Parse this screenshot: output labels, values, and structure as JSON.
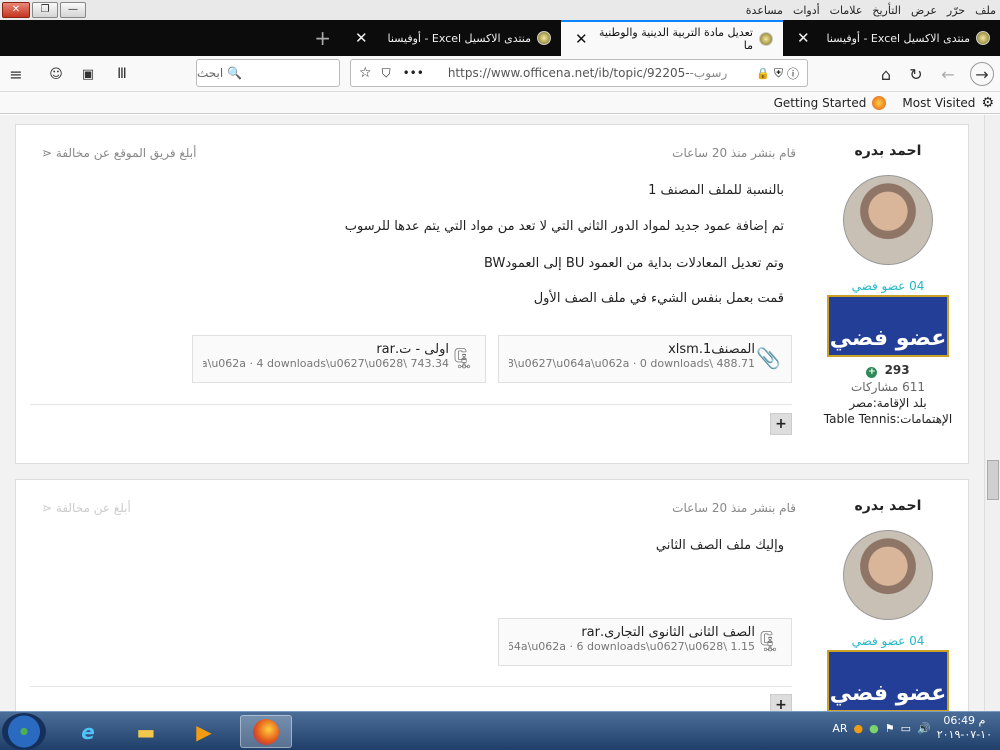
{
  "menu": {
    "items": [
      "ملف",
      "حرّر",
      "عرض",
      "التأريخ",
      "علامات",
      "أدوات",
      "مساعدة"
    ]
  },
  "window": {
    "minimize": "—",
    "restore": "❐",
    "close": "✕"
  },
  "tabs": [
    {
      "label": "منتدى الاكسيل Excel - أوفيسنا"
    },
    {
      "label": "تعديل مادة التربية الدينية والوطنية ما"
    },
    {
      "label": "منتدى الاكسيل Excel - أوفيسنا"
    }
  ],
  "new_tab": "+",
  "url": "https://www.officena.net/ib/topic/92205-",
  "url_suffix": "رسوب-",
  "search": {
    "placeholder": "ابحث"
  },
  "bookmarks": {
    "getting_started": "Getting Started",
    "most_visited": "Most Visited"
  },
  "posts": [
    {
      "author": "احمد بدره",
      "rank": "04 عضو فضي",
      "badge_text": "عضو فضي",
      "reputation": "293",
      "post_count": "611 مشاركات",
      "country": "بلد الإقامة:مصر",
      "interests": "الإهتمامات:Table Tennis",
      "posted": "قام بنشر منذ 20 ساعات",
      "report": "أبلغ فريق الموقع عن مخالفة",
      "lines": [
        "بالنسبة للملف المصنف 1",
        "تم إضافة عمود جديد لمواد الدور الثاني التي لا تعد من مواد التي يتم عدها للرسوب",
        "وتم تعديل المعادلات بداية من العمود BU إلى العمودBW",
        "قمت بعمل بنفس الشيء في ملف الصف الأول"
      ],
      "attachments": [
        {
          "name": "المصنف1.xlsm",
          "info": "488.71 \\u0628\\u0627\\u064a\\u062a · 0 downloads..."
        },
        {
          "name": "اولى - ت.rar",
          "info": "743.34 \\u064a\\u062a · 4 downloads\\u0627\\u0628..."
        }
      ]
    },
    {
      "author": "احمد بدره",
      "rank": "04 عضو فضي",
      "badge_text": "عضو فضي",
      "posted": "قام بنشر منذ 20 ساعات",
      "report": "أبلغ عن مخالفة",
      "lines": [
        "وإليك ملف الصف الثاني"
      ],
      "attachments": [
        {
          "name": "الصف الثانى الثانوى التجارى.rar",
          "info": "1.15 \\u0645\\u064a\\u062a · 6 downloads\\u0627\\u0628..."
        }
      ]
    }
  ],
  "taskbar": {
    "lang": "AR",
    "time": "06:49 م",
    "date": "١٠-٠٧-٢٠١٩"
  }
}
